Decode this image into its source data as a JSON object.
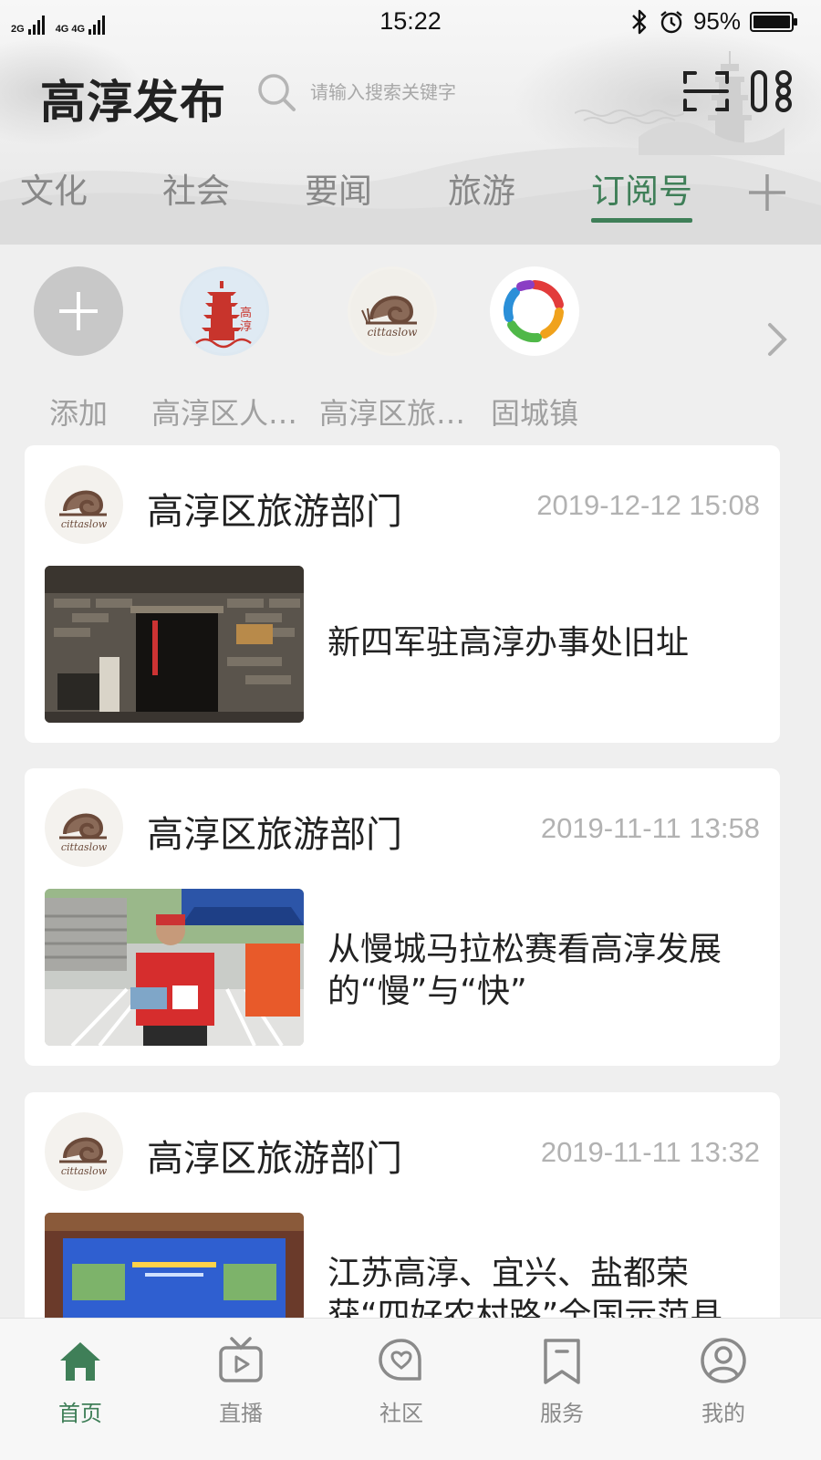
{
  "status_bar": {
    "network_left": "2G",
    "network_right": "4G 4G",
    "time": "15:22",
    "battery": "95%"
  },
  "header": {
    "title": "高淳发布",
    "search_placeholder": "请输入搜索关键字",
    "icons": [
      "search-icon",
      "scan-icon",
      "menu-icon"
    ]
  },
  "tabs": {
    "items": [
      {
        "label": "文化"
      },
      {
        "label": "社会"
      },
      {
        "label": "要闻"
      },
      {
        "label": "旅游"
      },
      {
        "label": "订阅号"
      }
    ],
    "active": "订阅号",
    "add_icon": "plus-icon"
  },
  "subscriptions": [
    {
      "label": "添加"
    },
    {
      "label": "高淳区人…"
    },
    {
      "label": "高淳区旅…"
    },
    {
      "label": "固城镇"
    }
  ],
  "feed": [
    {
      "source": "高淳区旅游部门",
      "time": "2019-12-12 15:08",
      "headline_lines": [
        "新四军驻高淳办事处旧址"
      ]
    },
    {
      "source": "高淳区旅游部门",
      "time": "2019-11-11 13:58",
      "headline_lines": [
        "从慢城马拉松赛看高淳发展",
        "的“慢”与“快”"
      ]
    },
    {
      "source": "高淳区旅游部门",
      "time": "2019-11-11 13:32",
      "headline_lines": [
        "江苏高淳、宜兴、盐都荣",
        "获“四好农村路”全国示范县"
      ]
    }
  ],
  "bottom_nav": [
    {
      "label": "首页",
      "icon": "home-icon"
    },
    {
      "label": "直播",
      "icon": "tv-play-icon"
    },
    {
      "label": "社区",
      "icon": "chat-heart-icon"
    },
    {
      "label": "服务",
      "icon": "bookmark-icon"
    },
    {
      "label": "我的",
      "icon": "user-icon"
    }
  ],
  "colors": {
    "accent": "#3f7f58",
    "background": "#efefef",
    "muted_text": "#a0a0a0"
  }
}
